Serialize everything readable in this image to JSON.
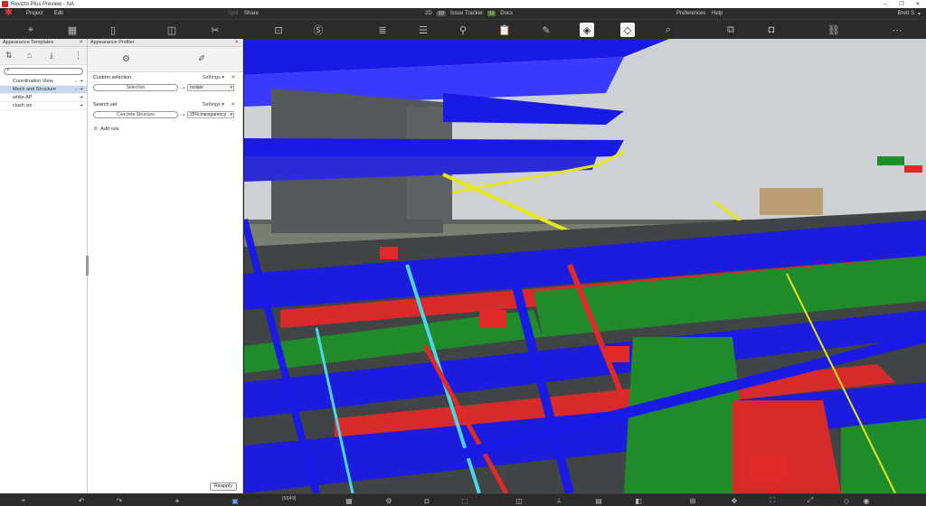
{
  "window": {
    "title": "Revizto Plus Preview - NA",
    "controls": [
      "–",
      "❐",
      "✕"
    ]
  },
  "menu": {
    "project": "Project",
    "edit": "Edit",
    "split": "Split",
    "share": "Share",
    "twod": "2D",
    "twod_badge": "3D",
    "issue_tracker": "Issue Tracker",
    "issue_badge": "11",
    "docs": "Docs",
    "preferences": "Preferences",
    "help": "Help",
    "user": "Brett S"
  },
  "templates_panel": {
    "title": "Appearance Templates",
    "search_placeholder": "",
    "items": [
      {
        "label": "Coordination View",
        "arrows": "⇔ ➜"
      },
      {
        "label": "Mech and Structure",
        "arrows": "⇔ ➜"
      },
      {
        "label": "white AP",
        "arrows": "➜"
      },
      {
        "label": "clash iso",
        "arrows": "➜"
      }
    ],
    "selected_index": 1
  },
  "profiler_panel": {
    "title": "Appearance Profiler",
    "rules": [
      {
        "label": "Custom selection",
        "settings": "Settings ▾",
        "target": "Selection",
        "mode": "Isolate"
      },
      {
        "label": "Search set",
        "settings": "Settings ▾",
        "target": "Concrete Structure",
        "mode": "25% transparency"
      }
    ],
    "add_rule": "Add rule",
    "reapply": "Reapply"
  },
  "statusbar": {
    "count": "[6849]"
  },
  "colors": {
    "duct_blue": "#1a1ae6",
    "pipe_red": "#e02a2a",
    "duct_green": "#1f8f2a",
    "steel_yellow": "#e6e61a",
    "pipe_cyan": "#4cd6e8",
    "selected_row": "#c7d8f0",
    "toolbar_bg": "#2b2b2b"
  }
}
